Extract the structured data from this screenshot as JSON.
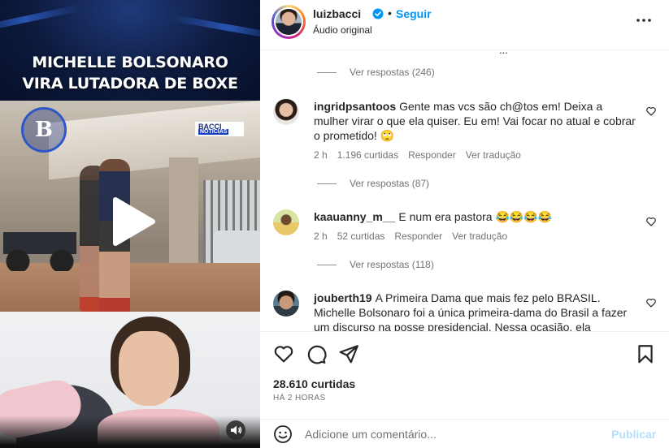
{
  "media": {
    "headline_line1": "MICHELLE BOLSONARO",
    "headline_line2": "VIRA LUTADORA DE BOXE",
    "logo_letter": "B",
    "tag_top": "BACCI",
    "tag_bottom": "NOTÍCIAS"
  },
  "header": {
    "username": "luizbacci",
    "separator": "•",
    "follow_label": "Seguir",
    "audio_label": "Áudio original"
  },
  "comments": {
    "clip_text": "...",
    "replies_1": "Ver respostas (246)",
    "items": [
      {
        "username": "ingridpsantoos",
        "text": "Gente mas vcs são ch@tos em! Deixa a mulher virar o que ela quiser. Eu em! Vai focar no atual e cobrar o prometido! 🙄",
        "time": "2 h",
        "likes": "1.196 curtidas",
        "reply": "Responder",
        "translate": "Ver tradução",
        "replies": "Ver respostas (87)"
      },
      {
        "username": "kaauanny_m__",
        "text": "E num era pastora 😂😂😂😂",
        "time": "2 h",
        "likes": "52 curtidas",
        "reply": "Responder",
        "translate": "Ver tradução",
        "replies": "Ver respostas (118)"
      },
      {
        "username": "jouberth19",
        "text": "A Primeira Dama que mais fez pelo BRASIL. Michelle Bolsonaro foi a única primeira-dama do Brasil a fazer um discurso na posse presidencial. Nessa ocasião, ela"
      }
    ]
  },
  "actions": {
    "likes_count": "28.610 curtidas",
    "time_ago": "HÁ 2 HORAS"
  },
  "composer": {
    "placeholder": "Adicione um comentário...",
    "publish_label": "Publicar"
  },
  "colors": {
    "link_blue": "#0095f6",
    "publish_disabled": "#b2dffc",
    "text": "#262626",
    "muted": "#737373"
  }
}
